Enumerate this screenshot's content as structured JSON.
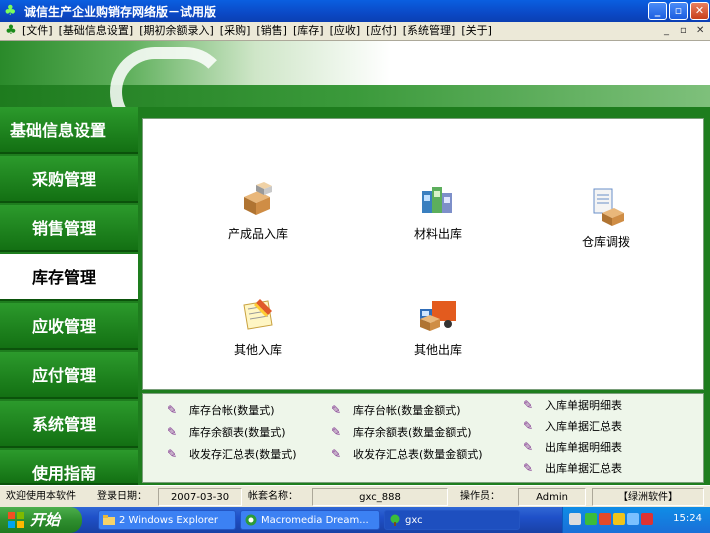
{
  "window": {
    "title": "诚信生产企业购销存网络版－试用版",
    "min_label": "_",
    "max_label": "▫",
    "close_label": "✕"
  },
  "menu": [
    "[文件]",
    "[基础信息设置]",
    "[期初余额录入]",
    "[采购]",
    "[销售]",
    "[库存]",
    "[应收]",
    "[应付]",
    "[系统管理]",
    "[关于]"
  ],
  "mdi": {
    "min": "_",
    "restore": "▫",
    "close": "✕"
  },
  "sidebar": {
    "items": [
      {
        "label": "基础信息设置",
        "active": false
      },
      {
        "label": "采购管理",
        "active": false
      },
      {
        "label": "销售管理",
        "active": false
      },
      {
        "label": "库存管理",
        "active": true
      },
      {
        "label": "应收管理",
        "active": false
      },
      {
        "label": "应付管理",
        "active": false
      },
      {
        "label": "系统管理",
        "active": false
      },
      {
        "label": "使用指南",
        "active": false
      }
    ]
  },
  "functions": [
    {
      "label": "产成品入库",
      "icon": "boxes-icon"
    },
    {
      "label": "材料出库",
      "icon": "materials-icon"
    },
    {
      "label": "仓库调拨",
      "icon": "document-box-icon"
    },
    {
      "label": "其他入库",
      "icon": "notebook-icon"
    },
    {
      "label": "其他出库",
      "icon": "delivery-truck-icon"
    }
  ],
  "reports": {
    "col1": [
      "库存台帐(数量式)",
      "库存余额表(数量式)",
      "收发存汇总表(数量式)"
    ],
    "col2": [
      "库存台帐(数量金额式)",
      "库存余额表(数量金额式)",
      "收发存汇总表(数量金额式)"
    ],
    "col3": [
      "入库单据明细表",
      "入库单据汇总表",
      "出库单据明细表",
      "出库单据汇总表"
    ]
  },
  "status": {
    "welcome": "欢迎使用本软件",
    "login_date_label": "登录日期：",
    "login_date": "2007-03-30",
    "account_label": "帐套名称：",
    "account": "gxc_888",
    "operator_label": "操作员：",
    "operator": "Admin",
    "vendor": "【绿洲软件】"
  },
  "taskbar": {
    "start": "开始",
    "tasks": [
      "2 Windows Explorer",
      "Macromedia Dream...",
      "gxc"
    ],
    "clock": "15:24"
  },
  "colors": {
    "sidebar_green": "#1e7d1e",
    "title_blue": "#0b49c6",
    "report_icon": "#7a2a8a"
  }
}
